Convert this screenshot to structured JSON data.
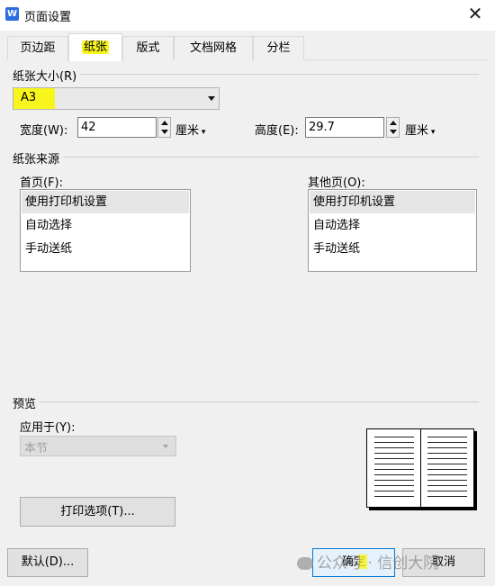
{
  "window": {
    "title": "页面设置",
    "app_icon_letter": "W",
    "close_glyph": "✕"
  },
  "tabs": [
    {
      "label": "页边距"
    },
    {
      "label": "纸张",
      "active": true
    },
    {
      "label": "版式"
    },
    {
      "label": "文档网格"
    },
    {
      "label": "分栏"
    }
  ],
  "paper_size": {
    "group_label": "纸张大小(R)",
    "selected": "A3",
    "width_label": "宽度(W):",
    "width_value": "42",
    "width_unit": "厘米",
    "height_label": "高度(E):",
    "height_value": "29.7",
    "height_unit": "厘米"
  },
  "paper_source": {
    "group_label": "纸张来源",
    "first_page": {
      "label": "首页(F):",
      "items": [
        "使用打印机设置",
        "自动选择",
        "手动送纸"
      ]
    },
    "other_pages": {
      "label": "其他页(O):",
      "items": [
        "使用打印机设置",
        "自动选择",
        "手动送纸"
      ]
    }
  },
  "preview": {
    "group_label": "预览",
    "apply_to_label": "应用于(Y):",
    "apply_to_value": "本节"
  },
  "buttons": {
    "print_options": "打印选项(T)...",
    "default": "默认(D)...",
    "ok": "确定",
    "cancel": "取消"
  },
  "watermark": {
    "text": "公众号 · 信创大院"
  },
  "colors": {
    "highlight": "#f8f51c",
    "app_icon": "#2b6ce0",
    "ok_border": "#0078d7"
  }
}
